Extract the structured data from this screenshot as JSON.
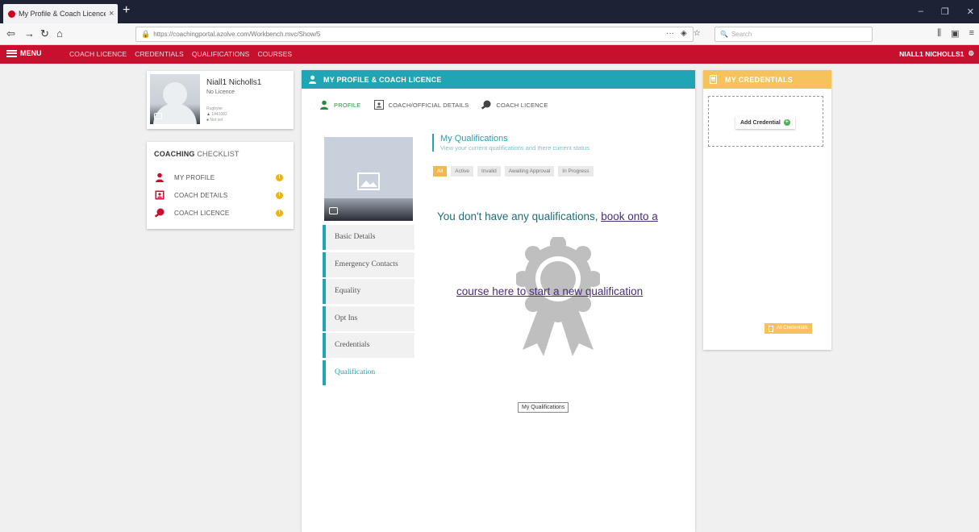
{
  "browser": {
    "tab_title": "My Profile & Coach Licence - ",
    "tab_close": "×",
    "new_tab": "+",
    "url": "https://coachingportal.azolve.com/Workbench.mvc/Show/5",
    "search_placeholder": "Search",
    "url_actions": "···",
    "window_min": "–",
    "window_max": "❐",
    "window_close": "✕"
  },
  "appbar": {
    "menu_label": "MENU",
    "links": [
      "COACH LICENCE",
      "CREDENTIALS",
      "QUALIFICATIONS",
      "COURSES"
    ],
    "user_name": "NIALL1 NICHOLLS1"
  },
  "profile": {
    "name": "Niall1 Nicholls1",
    "licence": "No Licence",
    "meta_line1": "Rugbyier",
    "meta_line2": "1441082",
    "meta_line3": "Not set"
  },
  "checklist": {
    "title_bold": "COACHING",
    "title_light": "CHECKLIST",
    "items": [
      {
        "label": "MY PROFILE",
        "status": "!"
      },
      {
        "label": "COACH DETAILS",
        "status": "!"
      },
      {
        "label": "COACH LICENCE",
        "status": "!"
      }
    ]
  },
  "main": {
    "header": "MY PROFILE & COACH LICENCE",
    "tabs": [
      "PROFILE",
      "COACH/OFFICIAL DETAILS",
      "COACH LICENCE"
    ],
    "side_nav": [
      "Basic Details",
      "Emergency Contacts",
      "Equality",
      "Opt Ins",
      "Credentials",
      "Qualification"
    ],
    "qualifications": {
      "title": "My Qualifications",
      "subtitle": "View your current qualifications and there current status",
      "filters": [
        "All",
        "Active",
        "Invalid",
        "Awaiting Approval",
        "In Progress"
      ],
      "empty_text_1": "You don't have any qualifications, ",
      "empty_link_1": "book onto a",
      "empty_link_2": "course here to start a new qualification",
      "button": "My Qualifications"
    }
  },
  "credentials": {
    "header": "MY CREDENTIALS",
    "add_label": "Add Credential",
    "all_label": "All Credentials"
  },
  "colors": {
    "red": "#c8102e",
    "teal": "#1fa5b3",
    "yellow": "#f6c25c",
    "green": "#2e8b3a"
  }
}
